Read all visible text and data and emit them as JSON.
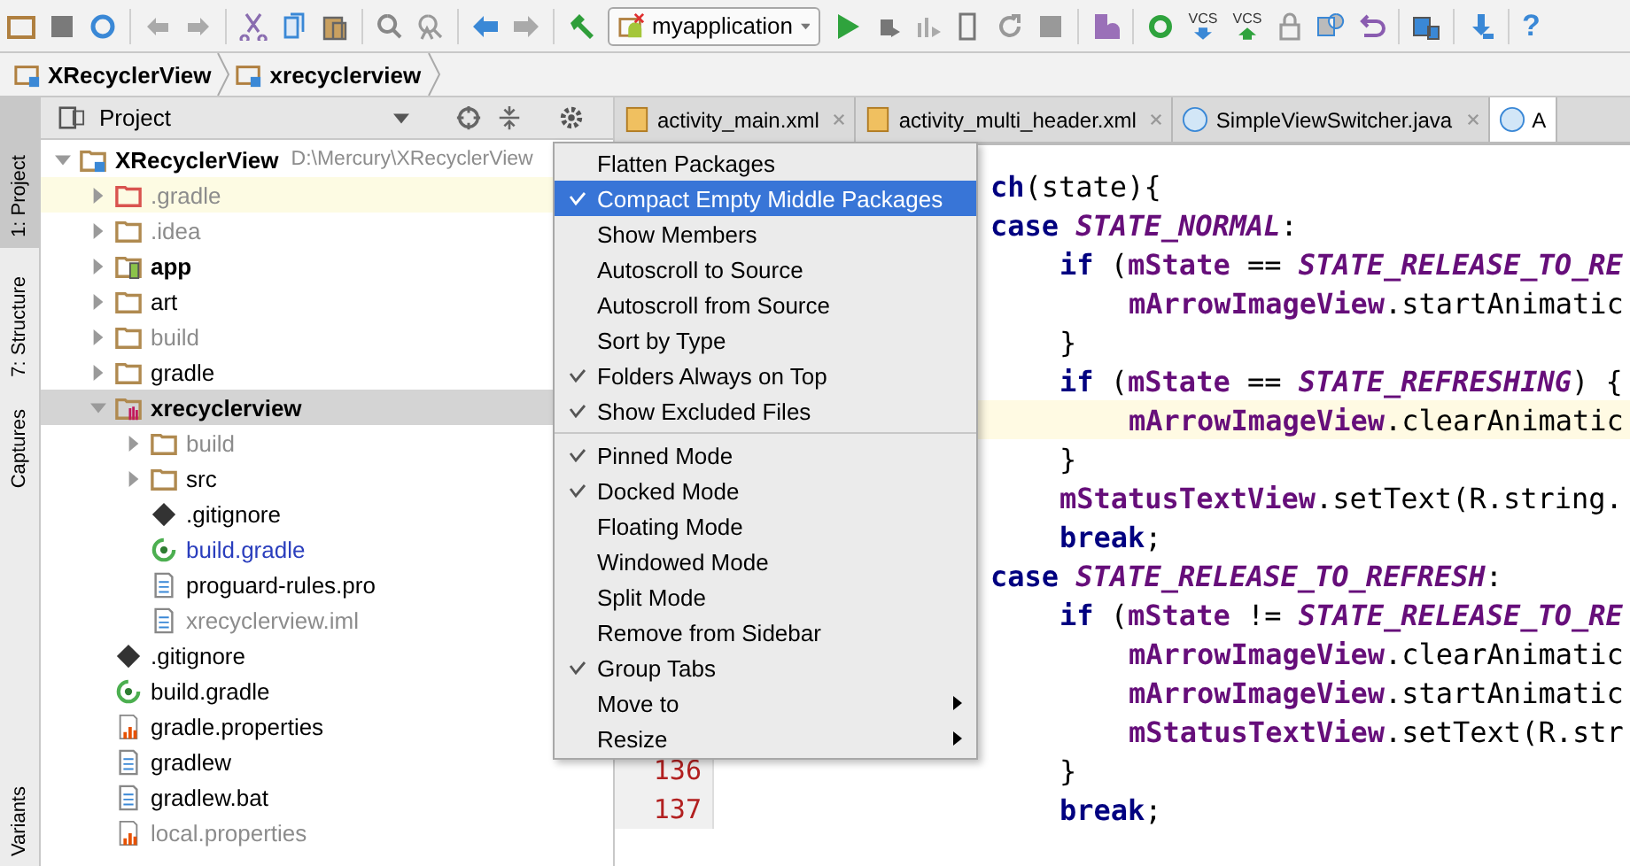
{
  "toolbar": {
    "run_config": "myapplication",
    "vcs_update_label": "VCS",
    "vcs_commit_label": "VCS",
    "help_label": "?"
  },
  "breadcrumbs": [
    {
      "label": "XRecyclerView"
    },
    {
      "label": "xrecyclerview"
    }
  ],
  "side_tabs": [
    {
      "label": "1: Project",
      "selected": true
    },
    {
      "label": "7: Structure",
      "selected": false
    },
    {
      "label": "Captures",
      "selected": false
    },
    {
      "label": "Variants",
      "selected": false
    }
  ],
  "project_panel": {
    "title": "Project",
    "tree": [
      {
        "name": "XRecyclerView",
        "path": "D:\\Mercury\\XRecyclerView",
        "kind": "root",
        "ignored": false,
        "modified": false,
        "bold": true,
        "expanded": true,
        "selected": false,
        "children": [
          {
            "name": ".gradle",
            "kind": "excluded-folder",
            "ignored": true,
            "modified": false,
            "bold": false,
            "expanded": false,
            "selected": false,
            "highlighted": true
          },
          {
            "name": ".idea",
            "kind": "folder",
            "ignored": true,
            "modified": false,
            "bold": false,
            "expanded": false,
            "selected": false
          },
          {
            "name": "app",
            "kind": "module",
            "ignored": false,
            "modified": false,
            "bold": true,
            "expanded": false,
            "selected": false
          },
          {
            "name": "art",
            "kind": "folder",
            "ignored": false,
            "modified": false,
            "bold": false,
            "expanded": false,
            "selected": false
          },
          {
            "name": "build",
            "kind": "folder",
            "ignored": true,
            "modified": false,
            "bold": false,
            "expanded": false,
            "selected": false
          },
          {
            "name": "gradle",
            "kind": "folder",
            "ignored": false,
            "modified": false,
            "bold": false,
            "expanded": false,
            "selected": false
          },
          {
            "name": "xrecyclerview",
            "kind": "library",
            "ignored": false,
            "modified": false,
            "bold": true,
            "expanded": true,
            "selected": true,
            "children": [
              {
                "name": "build",
                "kind": "folder",
                "ignored": true,
                "modified": false,
                "bold": false,
                "expanded": false,
                "selected": false
              },
              {
                "name": "src",
                "kind": "folder",
                "ignored": false,
                "modified": false,
                "bold": false,
                "expanded": false,
                "selected": false
              },
              {
                "name": ".gitignore",
                "kind": "git",
                "ignored": false,
                "modified": false,
                "bold": false,
                "selected": false
              },
              {
                "name": "build.gradle",
                "kind": "gradle",
                "ignored": false,
                "modified": true,
                "bold": false,
                "selected": false
              },
              {
                "name": "proguard-rules.pro",
                "kind": "text",
                "ignored": false,
                "modified": false,
                "bold": false,
                "selected": false
              },
              {
                "name": "xrecyclerview.iml",
                "kind": "iml",
                "ignored": true,
                "modified": false,
                "bold": false,
                "selected": false
              }
            ]
          },
          {
            "name": ".gitignore",
            "kind": "git",
            "ignored": false,
            "modified": false,
            "bold": false,
            "selected": false
          },
          {
            "name": "build.gradle",
            "kind": "gradle",
            "ignored": false,
            "modified": false,
            "bold": false,
            "selected": false
          },
          {
            "name": "gradle.properties",
            "kind": "properties",
            "ignored": false,
            "modified": false,
            "bold": false,
            "selected": false
          },
          {
            "name": "gradlew",
            "kind": "text",
            "ignored": false,
            "modified": false,
            "bold": false,
            "selected": false
          },
          {
            "name": "gradlew.bat",
            "kind": "text",
            "ignored": false,
            "modified": false,
            "bold": false,
            "selected": false
          },
          {
            "name": "local.properties",
            "kind": "properties",
            "ignored": true,
            "modified": false,
            "bold": false,
            "selected": false
          }
        ]
      }
    ]
  },
  "editor_tabs": [
    {
      "label": "activity_main.xml",
      "kind": "xml",
      "selected": false
    },
    {
      "label": "activity_multi_header.xml",
      "kind": "xml",
      "selected": false
    },
    {
      "label": "SimpleViewSwitcher.java",
      "kind": "class",
      "selected": false
    },
    {
      "label": "A",
      "kind": "class",
      "selected": true
    }
  ],
  "code_lines": [
    {
      "parts": [
        {
          "text": "ch",
          "kind": "keyword"
        },
        {
          "text": "(state){",
          "kind": "plain"
        }
      ],
      "children": [
        {
          "parts": [
            {
              "text": "case ",
              "kind": "keyword"
            },
            {
              "text": "STATE_NORMAL",
              "kind": "constant"
            },
            {
              "text": ":",
              "kind": "plain"
            }
          ],
          "children": [
            {
              "parts": [
                {
                  "text": "if",
                  "kind": "keyword"
                },
                {
                  "text": " (",
                  "kind": "plain"
                },
                {
                  "text": "mState",
                  "kind": "field"
                },
                {
                  "text": " == ",
                  "kind": "plain"
                },
                {
                  "text": "STATE_RELEASE_TO_RE",
                  "kind": "constant"
                }
              ],
              "children": [
                {
                  "parts": [
                    {
                      "text": "mArrowImageView",
                      "kind": "field"
                    },
                    {
                      "text": ".startAnimatic",
                      "kind": "plain"
                    }
                  ]
                }
              ]
            },
            {
              "parts": [
                {
                  "text": "}",
                  "kind": "plain"
                }
              ]
            },
            {
              "parts": [
                {
                  "text": "if",
                  "kind": "keyword"
                },
                {
                  "text": " (",
                  "kind": "plain"
                },
                {
                  "text": "mState",
                  "kind": "field"
                },
                {
                  "text": " == ",
                  "kind": "plain"
                },
                {
                  "text": "STATE_REFRESHING",
                  "kind": "constant"
                },
                {
                  "text": ") {",
                  "kind": "plain"
                }
              ],
              "children": [
                {
                  "highlighted": true,
                  "parts": [
                    {
                      "text": "mArrowImageView",
                      "kind": "field"
                    },
                    {
                      "text": ".clearAnimatic",
                      "kind": "plain"
                    }
                  ]
                }
              ]
            },
            {
              "parts": [
                {
                  "text": "}",
                  "kind": "plain"
                }
              ]
            },
            {
              "parts": [
                {
                  "text": "mStatusTextView",
                  "kind": "field"
                },
                {
                  "text": ".setText(R.string.",
                  "kind": "plain"
                }
              ]
            },
            {
              "parts": [
                {
                  "text": "break",
                  "kind": "keyword"
                },
                {
                  "text": ";",
                  "kind": "plain"
                }
              ]
            }
          ]
        },
        {
          "parts": [
            {
              "text": "case ",
              "kind": "keyword"
            },
            {
              "text": "STATE_RELEASE_TO_REFRESH",
              "kind": "constant"
            },
            {
              "text": ":",
              "kind": "plain"
            }
          ],
          "children": [
            {
              "parts": [
                {
                  "text": "if",
                  "kind": "keyword"
                },
                {
                  "text": " (",
                  "kind": "plain"
                },
                {
                  "text": "mState",
                  "kind": "field"
                },
                {
                  "text": " != ",
                  "kind": "plain"
                },
                {
                  "text": "STATE_RELEASE_TO_RE",
                  "kind": "constant"
                }
              ],
              "children": [
                {
                  "parts": [
                    {
                      "text": "mArrowImageView",
                      "kind": "field"
                    },
                    {
                      "text": ".clearAnimatic",
                      "kind": "plain"
                    }
                  ]
                },
                {
                  "parts": [
                    {
                      "text": "mArrowImageView",
                      "kind": "field"
                    },
                    {
                      "text": ".startAnimatic",
                      "kind": "plain"
                    }
                  ]
                },
                {
                  "parts": [
                    {
                      "text": "mStatusTextView",
                      "kind": "field"
                    },
                    {
                      "text": ".setText(R.str",
                      "kind": "plain"
                    }
                  ]
                }
              ]
            },
            {
              "line_number": "136",
              "parts": [
                {
                  "text": "}",
                  "kind": "plain"
                }
              ]
            },
            {
              "line_number": "137",
              "parts": [
                {
                  "text": "break",
                  "kind": "keyword"
                },
                {
                  "text": ";",
                  "kind": "plain"
                }
              ]
            }
          ]
        }
      ]
    }
  ],
  "context_menu": {
    "groups": [
      [
        {
          "label": "Flatten Packages",
          "checked": false,
          "selected": false,
          "submenu": false
        },
        {
          "label": "Compact Empty Middle Packages",
          "checked": true,
          "selected": true,
          "submenu": false
        },
        {
          "label": "Show Members",
          "checked": false,
          "selected": false,
          "submenu": false
        },
        {
          "label": "Autoscroll to Source",
          "checked": false,
          "selected": false,
          "submenu": false
        },
        {
          "label": "Autoscroll from Source",
          "checked": false,
          "selected": false,
          "submenu": false
        },
        {
          "label": "Sort by Type",
          "checked": false,
          "selected": false,
          "submenu": false
        },
        {
          "label": "Folders Always on Top",
          "checked": true,
          "selected": false,
          "submenu": false
        },
        {
          "label": "Show Excluded Files",
          "checked": true,
          "selected": false,
          "submenu": false
        }
      ],
      [
        {
          "label": "Pinned Mode",
          "checked": true,
          "selected": false,
          "submenu": false
        },
        {
          "label": "Docked Mode",
          "checked": true,
          "selected": false,
          "submenu": false
        },
        {
          "label": "Floating Mode",
          "checked": false,
          "selected": false,
          "submenu": false
        },
        {
          "label": "Windowed Mode",
          "checked": false,
          "selected": false,
          "submenu": false
        },
        {
          "label": "Split Mode",
          "checked": false,
          "selected": false,
          "submenu": false
        },
        {
          "label": "Remove from Sidebar",
          "checked": false,
          "selected": false,
          "submenu": false
        },
        {
          "label": "Group Tabs",
          "checked": true,
          "selected": false,
          "submenu": false
        },
        {
          "label": "Move to",
          "checked": false,
          "selected": false,
          "submenu": true
        },
        {
          "label": "Resize",
          "checked": false,
          "selected": false,
          "submenu": true
        }
      ]
    ]
  }
}
